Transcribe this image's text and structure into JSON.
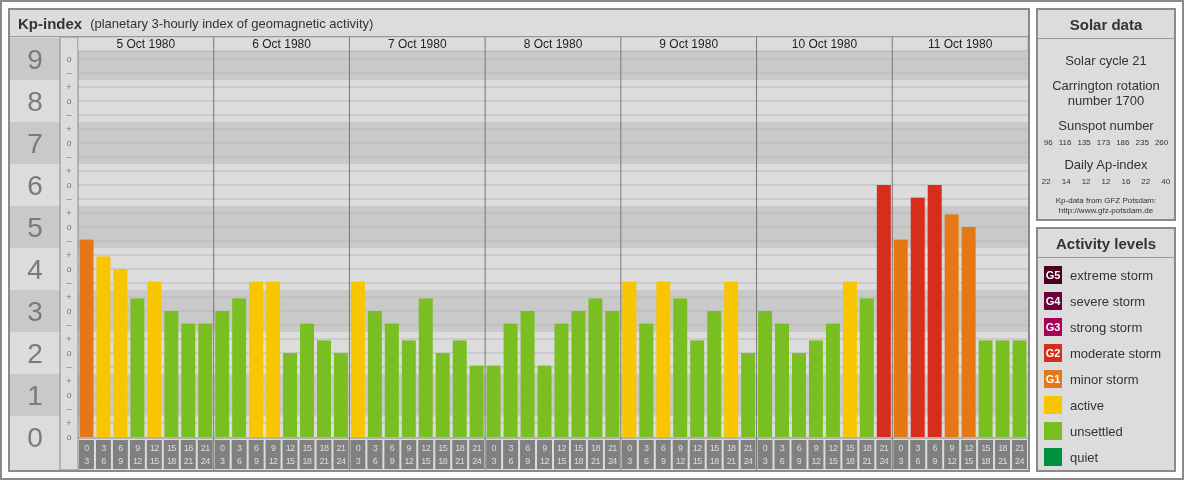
{
  "title": {
    "main": "Kp-index",
    "subtitle": "(planetary 3-hourly index of geomagnetic activity)"
  },
  "chart": {
    "days": [
      "5 Oct 1980",
      "6 Oct 1980",
      "7 Oct 1980",
      "8 Oct 1980",
      "9 Oct 1980",
      "10 Oct 1980",
      "11 Oct 1980"
    ],
    "sub_ticks": [
      "o",
      "–",
      "+",
      "o",
      "–",
      "+",
      "o",
      "–",
      "+",
      "o",
      "–",
      "+",
      "o",
      "–",
      "+",
      "o",
      "–",
      "+",
      "o",
      "–",
      "+",
      "o",
      "–",
      "+",
      "o",
      "–",
      "+",
      "o"
    ],
    "chart_data": {
      "type": "bar",
      "ylim": [
        0,
        9
      ],
      "grid": true,
      "yticks": [
        {
          "value": 0,
          "label": "0"
        },
        {
          "value": 1,
          "label": "1"
        },
        {
          "value": 2,
          "label": "2"
        },
        {
          "value": 3,
          "label": "3"
        },
        {
          "value": 4,
          "label": "4"
        },
        {
          "value": 5,
          "label": "5"
        },
        {
          "value": 6,
          "label": "6"
        },
        {
          "value": 7,
          "label": "7"
        },
        {
          "value": 8,
          "label": "8"
        },
        {
          "value": 9,
          "label": "9"
        }
      ],
      "categories": [
        "0\n3",
        "3\n6",
        "6\n9",
        "9\n12",
        "12\n15",
        "15\n18",
        "18\n21",
        "21\n24",
        "0\n3",
        "3\n6",
        "6\n9",
        "9\n12",
        "12\n15",
        "15\n18",
        "18\n21",
        "21\n24",
        "0\n3",
        "3\n6",
        "6\n9",
        "9\n12",
        "12\n15",
        "15\n18",
        "18\n21",
        "21\n24",
        "0\n3",
        "3\n6",
        "6\n9",
        "9\n12",
        "12\n15",
        "15\n18",
        "18\n21",
        "21\n24",
        "0\n3",
        "3\n6",
        "6\n9",
        "9\n12",
        "12\n15",
        "15\n18",
        "18\n21",
        "21\n24",
        "0\n3",
        "3\n6",
        "6\n9",
        "9\n12",
        "12\n15",
        "15\n18",
        "18\n21",
        "21\n24",
        "0\n3",
        "3\n6",
        "6\n9",
        "9\n12",
        "12\n15",
        "15\n18",
        "18\n21",
        "21\n24"
      ],
      "values": [
        4.7,
        4.3,
        4,
        3.3,
        3.7,
        3,
        2.7,
        2.7,
        3,
        3.3,
        3.7,
        3.7,
        2,
        2.7,
        2.3,
        2,
        3.7,
        3,
        2.7,
        2.3,
        3.3,
        2,
        2.3,
        1.7,
        1.7,
        2.7,
        3,
        1.7,
        2.7,
        3,
        3.3,
        3,
        3.7,
        2.7,
        3.7,
        3.3,
        2.3,
        3,
        3.7,
        2,
        3,
        2.7,
        2,
        2.3,
        2.7,
        3.7,
        3.3,
        6,
        4.7,
        5.7,
        6,
        5.3,
        5,
        2.3,
        2.3,
        2.3
      ]
    }
  },
  "solar_data": {
    "title": "Solar data",
    "cycle": "Solar cycle 21",
    "rotation": "Carrington rotation number 1700",
    "sunspot_label": "Sunspot number",
    "sunspot_values": [
      "96",
      "116",
      "135",
      "173",
      "186",
      "235",
      "260"
    ],
    "ap_label": "Daily Ap-index",
    "ap_values": [
      "22",
      "14",
      "12",
      "12",
      "16",
      "22",
      "40"
    ],
    "credit": [
      "Kp-data from GFZ Potsdam:",
      "http://www.gfz-potsdam.de"
    ]
  },
  "activity_levels": {
    "title": "Activity levels",
    "items": [
      {
        "badge": "G5",
        "label": "extreme storm",
        "color": "#4a0022"
      },
      {
        "badge": "G4",
        "label": "severe storm",
        "color": "#6c0038"
      },
      {
        "badge": "G3",
        "label": "strong storm",
        "color": "#a3005c"
      },
      {
        "badge": "G2",
        "label": "moderate storm",
        "color": "#d62d1d"
      },
      {
        "badge": "G1",
        "label": "minor storm",
        "color": "#e47816"
      },
      {
        "label": "active",
        "color": "#f8c600"
      },
      {
        "label": "unsettled",
        "color": "#79bf22"
      },
      {
        "label": "quiet",
        "color": "#009140"
      }
    ]
  }
}
